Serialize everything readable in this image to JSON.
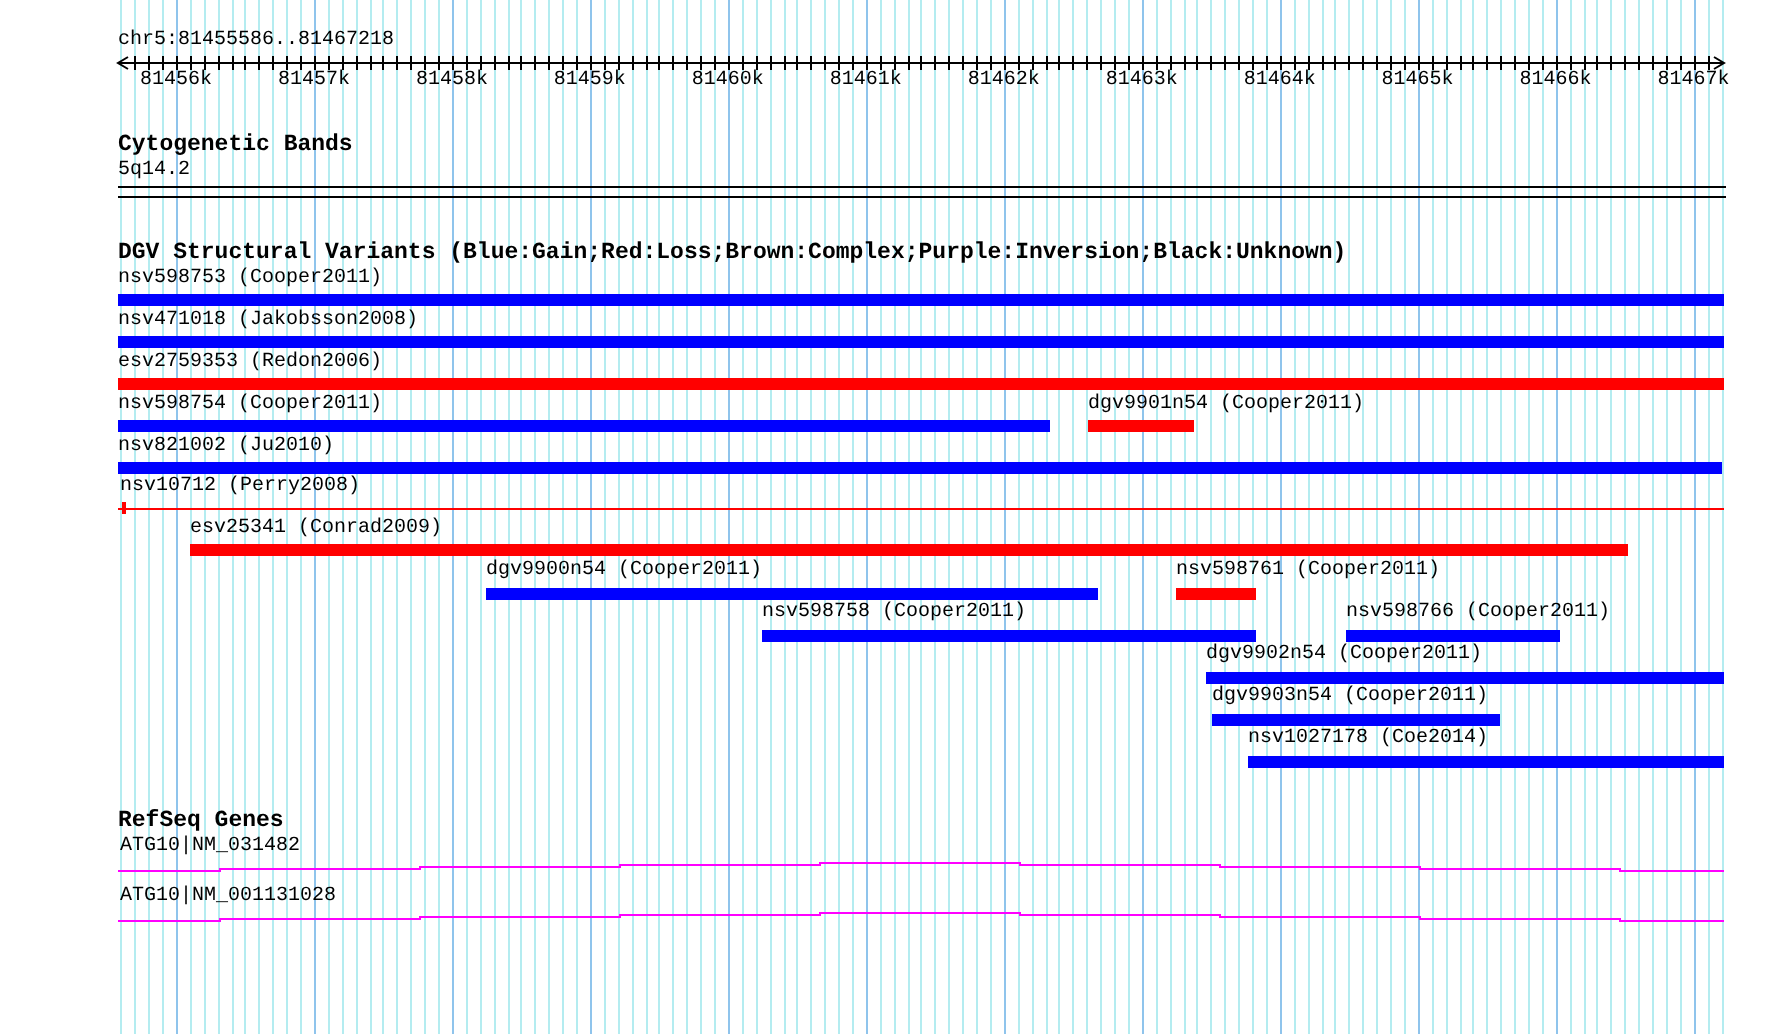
{
  "location": "chr5:81455586..81467218",
  "ruler": {
    "ticks": [
      "81456k",
      "81457k",
      "81458k",
      "81459k",
      "81460k",
      "81461k",
      "81462k",
      "81463k",
      "81464k",
      "81465k",
      "81466k",
      "81467k"
    ]
  },
  "tracks": [
    {
      "kind": "bands",
      "title": "Cytogenetic Bands",
      "items": [
        {
          "label": "5q14.2"
        }
      ]
    },
    {
      "kind": "variants",
      "title": "DGV Structural Variants (Blue:Gain;Red:Loss;Brown:Complex;Purple:Inversion;Black:Unknown)",
      "items": [
        {
          "label": "nsv598753 (Cooper2011)",
          "color": "#0000ff",
          "kind": "bar"
        },
        {
          "label": "nsv471018 (Jakobsson2008)",
          "color": "#0000ff",
          "kind": "bar"
        },
        {
          "label": "esv2759353 (Redon2006)",
          "color": "#ff0000",
          "kind": "bar"
        },
        {
          "label": "nsv598754 (Cooper2011)",
          "color": "#0000ff",
          "kind": "bar"
        },
        {
          "label": "dgv9901n54 (Cooper2011)",
          "color": "#ff0000",
          "kind": "bar"
        },
        {
          "label": "nsv821002 (Ju2010)",
          "color": "#0000ff",
          "kind": "bar"
        },
        {
          "label": "nsv10712 (Perry2008)",
          "color": "#ff0000",
          "kind": "line"
        },
        {
          "label": "esv25341 (Conrad2009)",
          "color": "#ff0000",
          "kind": "bar"
        },
        {
          "label": "dgv9900n54 (Cooper2011)",
          "color": "#0000ff",
          "kind": "bar"
        },
        {
          "label": "nsv598761 (Cooper2011)",
          "color": "#ff0000",
          "kind": "bar"
        },
        {
          "label": "nsv598758 (Cooper2011)",
          "color": "#0000ff",
          "kind": "bar"
        },
        {
          "label": "nsv598766 (Cooper2011)",
          "color": "#0000ff",
          "kind": "bar"
        },
        {
          "label": "dgv9902n54 (Cooper2011)",
          "color": "#0000ff",
          "kind": "bar"
        },
        {
          "label": "dgv9903n54 (Cooper2011)",
          "color": "#0000ff",
          "kind": "bar"
        },
        {
          "label": "nsv1027178 (Coe2014)",
          "color": "#0000ff",
          "kind": "bar"
        }
      ]
    },
    {
      "kind": "genes",
      "title": "RefSeq Genes",
      "items": [
        {
          "label": "ATG10|NM_031482"
        },
        {
          "label": "ATG10|NM_001131028"
        }
      ]
    }
  ]
}
